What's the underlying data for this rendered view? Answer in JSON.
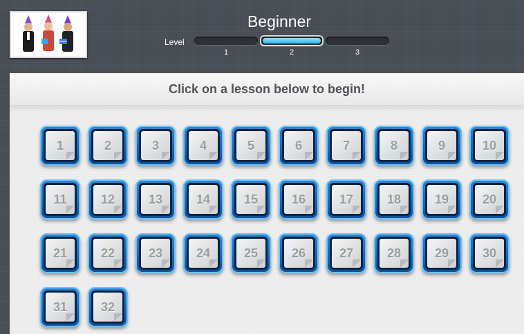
{
  "header": {
    "title": "Beginner",
    "level_label": "Level",
    "levels": [
      {
        "label": "1",
        "active": false
      },
      {
        "label": "2",
        "active": true
      },
      {
        "label": "3",
        "active": false
      }
    ],
    "accent_color": "#4fc8f2"
  },
  "panel": {
    "heading": "Click on a lesson below to begin!"
  },
  "lessons": [
    "1",
    "2",
    "3",
    "4",
    "5",
    "6",
    "7",
    "8",
    "9",
    "10",
    "11",
    "12",
    "13",
    "14",
    "15",
    "16",
    "17",
    "18",
    "19",
    "20",
    "21",
    "22",
    "23",
    "24",
    "25",
    "26",
    "27",
    "28",
    "29",
    "30",
    "31",
    "32"
  ],
  "icons": {
    "thumbnail": "party-people-thumbnail",
    "lesson": "paper-note-icon"
  }
}
